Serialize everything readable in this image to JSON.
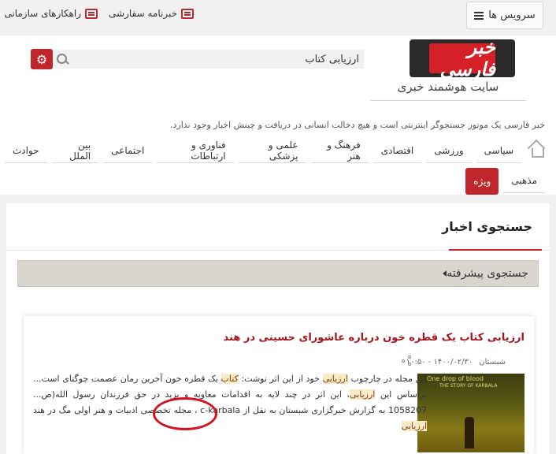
{
  "topbar": {
    "services_label": "سرویس ها",
    "links": [
      {
        "label": "خبرنامه سفارشی",
        "icon": "newsletter-icon"
      },
      {
        "label": "راهکارهای سازمانی",
        "icon": "monitor-icon"
      }
    ]
  },
  "header": {
    "logo_text": "خبر فارسی",
    "tagline": "سایت هوشمند خبری",
    "search_value": "ارزیابی کتاب",
    "description": "خبر فارسی یک موتور جستجوگر اینترنتی است و هیچ دخالت انسانی در دریافت و چینش اخبار وجود ندارد."
  },
  "nav": {
    "row1": [
      "سیاسی",
      "ورزشی",
      "اقتصادی",
      "فرهنگ و هنر",
      "علمی و پزشکی",
      "فناوری و ارتباطات",
      "اجتماعی",
      "بین الملل",
      "حوادث"
    ],
    "row2": [
      "مذهبی",
      "ویژه"
    ]
  },
  "main": {
    "title": "جستجوی اخبار",
    "advanced_search_label": "جستجوی پیشرفته"
  },
  "result": {
    "title": "ارزیابی کتاب یک قطره خون درباره عاشورای حسینی در هند",
    "source": "شبستان",
    "date": "۱۴۰۰/۰۲/۳۰ - ۱۰:۵۰",
    "thumb_title": "One drop of blood",
    "thumb_subtitle": "THE STORY OF KARBALA",
    "snippet": {
      "line1_a": "این مجله در چارچوب ",
      "hl1": "ارزیابی",
      "line1_b": " خود از این اثر نوشت: ",
      "hl2": "کتاب",
      "line1_c": " یک قطره خون آخرین رمان عصمت چوگتای است... براساس این ",
      "hl3": "ارزیابی",
      "line1_d": "، این اثر در چند لایه به اقدامات معاویه و یزید در حق فرزندان رسول الله(ص... 1058207 به گزارش خبرگزاری شبستان به نقل از c-karbala ، مجله تخصصی ادبیات و هنر اولی مگ در هند ",
      "hl4": "ارزیابی"
    }
  },
  "colors": {
    "accent": "#c0272d",
    "title_red": "#a3151b",
    "bg": "#f1f1f1"
  }
}
